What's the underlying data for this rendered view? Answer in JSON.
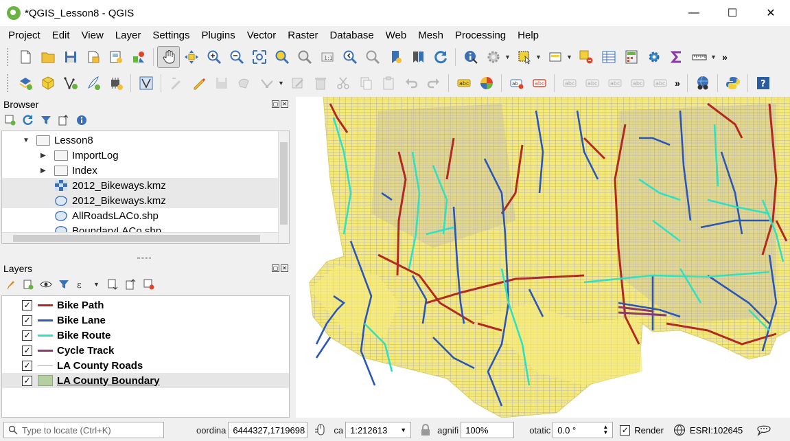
{
  "window": {
    "title": "*QGIS_Lesson8 - QGIS",
    "minimize": "—",
    "maximize": "☐",
    "close": "✕"
  },
  "menu": [
    "Project",
    "Edit",
    "View",
    "Layer",
    "Settings",
    "Plugins",
    "Vector",
    "Raster",
    "Database",
    "Web",
    "Mesh",
    "Processing",
    "Help"
  ],
  "browser": {
    "title": "Browser",
    "items": [
      {
        "label": "Lesson8",
        "icon": "folder-icon"
      },
      {
        "label": "ImportLog",
        "icon": "folder-icon"
      },
      {
        "label": "Index",
        "icon": "folder-icon"
      },
      {
        "label": "2012_Bikeways.kmz",
        "icon": "raster-layer-icon"
      },
      {
        "label": "2012_Bikeways.kmz",
        "icon": "vector-layer-icon"
      },
      {
        "label": "AllRoadsLACo.shp",
        "icon": "vector-layer-icon"
      },
      {
        "label": "BoundaryLACo.shp",
        "icon": "vector-layer-icon"
      }
    ]
  },
  "layers": {
    "title": "Layers",
    "items": [
      {
        "label": "Bike Path",
        "color": "#b22a1f",
        "checked": true
      },
      {
        "label": "Bike Lane",
        "color": "#2a56b8",
        "checked": true
      },
      {
        "label": "Bike Route",
        "color": "#2ee0c4",
        "checked": true
      },
      {
        "label": "Cycle Track",
        "color": "#8c3a6e",
        "checked": true
      },
      {
        "label": "LA County Roads",
        "color": "#b0b0b0",
        "checked": true
      },
      {
        "label": "LA County Boundary",
        "color": "#b5cfa0",
        "checked": true
      }
    ]
  },
  "colors": {
    "boundary_fill": "#f5e97a",
    "roads": "#b5b0ab",
    "bike_path": "#b22a1f",
    "bike_lane": "#2a56b8",
    "bike_route": "#2ee0c4",
    "cycle_track": "#8c3a6e"
  },
  "status": {
    "locator_placeholder": "Type to locate (Ctrl+K)",
    "coordinate_label": "oordina",
    "coordinate_value": "6444327,1719698",
    "scale_label": "ca",
    "scale_value": "1:212613",
    "magnifier_label": "agnifi",
    "magnifier_value": "100%",
    "rotation_label": "otatic",
    "rotation_value": "0.0 °",
    "render_label": "Render",
    "crs": "ESRI:102645"
  }
}
